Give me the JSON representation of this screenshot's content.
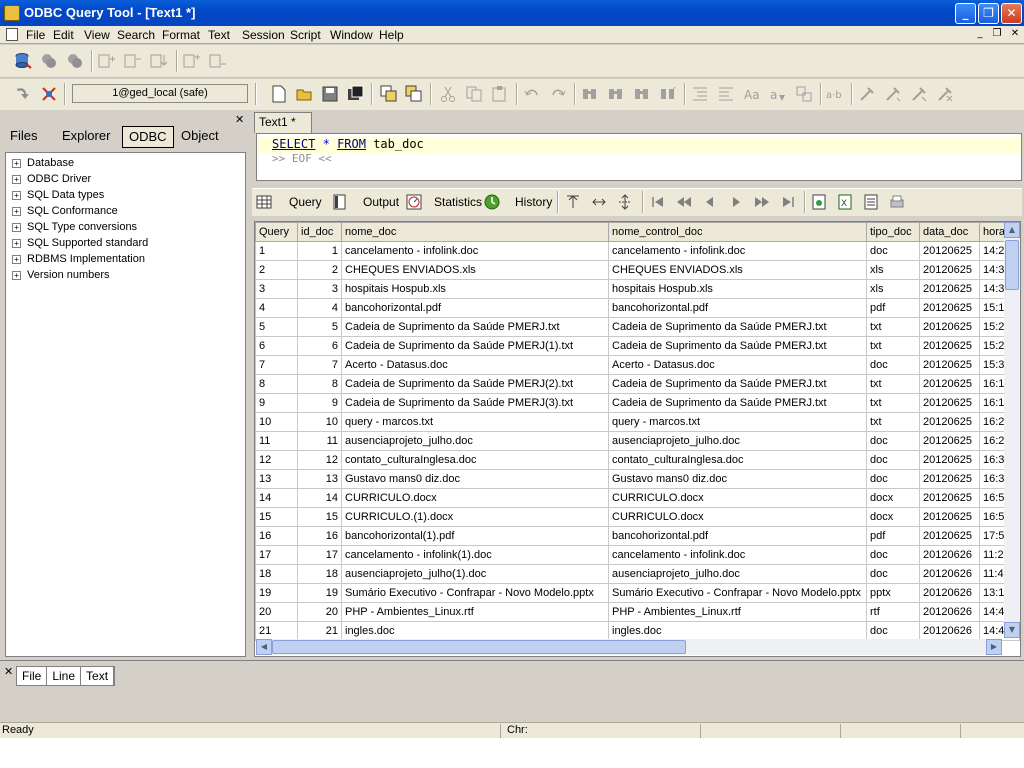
{
  "window": {
    "title": "ODBC Query Tool - [Text1 *]",
    "minimize": "_",
    "maximize": "❐",
    "close": "✕"
  },
  "menubar": {
    "items": [
      "File",
      "Edit",
      "View",
      "Search",
      "Format",
      "Text",
      "Session",
      "Script",
      "Window",
      "Help"
    ],
    "mdi_min": "_",
    "mdi_restore": "❐",
    "mdi_close": "✕"
  },
  "connection": {
    "label": "1@ged_local (safe)"
  },
  "left_panel": {
    "tabs": [
      "Files",
      "Explorer",
      "ODBC",
      "Object"
    ],
    "active_tab": "ODBC",
    "close": "✕",
    "tree": [
      "Database",
      "ODBC Driver",
      "SQL Data types",
      "SQL Conformance",
      "SQL Type conversions",
      "SQL Supported standard",
      "RDBMS Implementation",
      "Version numbers"
    ]
  },
  "editor": {
    "tab": "Text1 *",
    "sql": {
      "select": "SELECT",
      "star": "*",
      "from": "FROM",
      "table": "tab_doc"
    },
    "eof": ">> EOF <<"
  },
  "results_toolbar": {
    "query": "Query",
    "output": "Output",
    "statistics": "Statistics",
    "history": "History"
  },
  "grid": {
    "columns": [
      "Query",
      "id_doc",
      "nome_doc",
      "nome_control_doc",
      "tipo_doc",
      "data_doc",
      "hora"
    ],
    "rows": [
      [
        "1",
        "1",
        "cancelamento - infolink.doc",
        "cancelamento - infolink.doc",
        "doc",
        "20120625",
        "14:2"
      ],
      [
        "2",
        "2",
        "CHEQUES ENVIADOS.xls",
        "CHEQUES ENVIADOS.xls",
        "xls",
        "20120625",
        "14:3"
      ],
      [
        "3",
        "3",
        "hospitais Hospub.xls",
        "hospitais Hospub.xls",
        "xls",
        "20120625",
        "14:3"
      ],
      [
        "4",
        "4",
        "bancohorizontal.pdf",
        "bancohorizontal.pdf",
        "pdf",
        "20120625",
        "15:1"
      ],
      [
        "5",
        "5",
        "Cadeia de Suprimento da Saúde PMERJ.txt",
        "Cadeia de Suprimento da Saúde PMERJ.txt",
        "txt",
        "20120625",
        "15:2"
      ],
      [
        "6",
        "6",
        "Cadeia de Suprimento da Saúde PMERJ(1).txt",
        "Cadeia de Suprimento da Saúde PMERJ.txt",
        "txt",
        "20120625",
        "15:2"
      ],
      [
        "7",
        "7",
        "Acerto - Datasus.doc",
        "Acerto - Datasus.doc",
        "doc",
        "20120625",
        "15:3"
      ],
      [
        "8",
        "8",
        "Cadeia de Suprimento da Saúde PMERJ(2).txt",
        "Cadeia de Suprimento da Saúde PMERJ.txt",
        "txt",
        "20120625",
        "16:1"
      ],
      [
        "9",
        "9",
        "Cadeia de Suprimento da Saúde PMERJ(3).txt",
        "Cadeia de Suprimento da Saúde PMERJ.txt",
        "txt",
        "20120625",
        "16:1"
      ],
      [
        "10",
        "10",
        "query - marcos.txt",
        "query - marcos.txt",
        "txt",
        "20120625",
        "16:2"
      ],
      [
        "11",
        "11",
        "ausenciaprojeto_julho.doc",
        "ausenciaprojeto_julho.doc",
        "doc",
        "20120625",
        "16:2"
      ],
      [
        "12",
        "12",
        "contato_culturaInglesa.doc",
        "contato_culturaInglesa.doc",
        "doc",
        "20120625",
        "16:3"
      ],
      [
        "13",
        "13",
        "Gustavo mans0 diz.doc",
        "Gustavo mans0 diz.doc",
        "doc",
        "20120625",
        "16:3"
      ],
      [
        "14",
        "14",
        "CURRICULO.docx",
        "CURRICULO.docx",
        "docx",
        "20120625",
        "16:5"
      ],
      [
        "15",
        "15",
        "CURRICULO.(1).docx",
        "CURRICULO.docx",
        "docx",
        "20120625",
        "16:5"
      ],
      [
        "16",
        "16",
        "bancohorizontal(1).pdf",
        "bancohorizontal.pdf",
        "pdf",
        "20120625",
        "17:5"
      ],
      [
        "17",
        "17",
        "cancelamento - infolink(1).doc",
        "cancelamento - infolink.doc",
        "doc",
        "20120626",
        "11:2"
      ],
      [
        "18",
        "18",
        "ausenciaprojeto_julho(1).doc",
        "ausenciaprojeto_julho.doc",
        "doc",
        "20120626",
        "11:4"
      ],
      [
        "19",
        "19",
        "Sumário Executivo - Confrapar - Novo Modelo.pptx",
        "Sumário Executivo - Confrapar - Novo Modelo.pptx",
        "pptx",
        "20120626",
        "13:1"
      ],
      [
        "20",
        "20",
        "PHP - Ambientes_Linux.rtf",
        "PHP - Ambientes_Linux.rtf",
        "rtf",
        "20120626",
        "14:4"
      ],
      [
        "21",
        "21",
        "ingles.doc",
        "ingles.doc",
        "doc",
        "20120626",
        "14:4"
      ]
    ]
  },
  "bottom_panel": {
    "close": "✕",
    "tabs": [
      "File",
      "Line",
      "Text"
    ]
  },
  "statusbar": {
    "status": "Ready",
    "chr_label": "Chr:"
  }
}
